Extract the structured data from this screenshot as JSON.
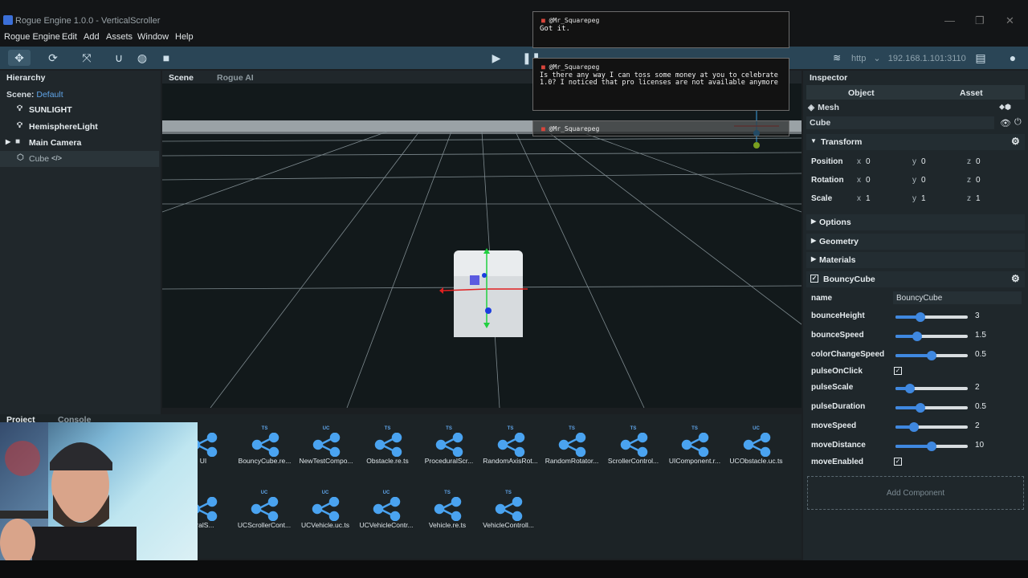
{
  "window": {
    "title": "Rogue Engine 1.0.0 - VerticalScroller"
  },
  "menu": [
    "Rogue Engine",
    "Edit",
    "Add",
    "Assets",
    "Window",
    "Help"
  ],
  "toolbar": {
    "protocol": "http",
    "address": "192.168.1.101:3110"
  },
  "hierarchy": {
    "tab": "Hierarchy",
    "scene_label": "Scene:",
    "scene_name": "Default",
    "items": [
      {
        "label": "SUNLIGHT",
        "icon": "bulb-icon"
      },
      {
        "label": "HemisphereLight",
        "icon": "bulb-icon"
      },
      {
        "label": "Main Camera",
        "icon": "camera-icon"
      },
      {
        "label": "Cube",
        "icon": "cube-icon"
      }
    ]
  },
  "scene_tabs": [
    "Scene",
    "Rogue AI"
  ],
  "bottom_tabs": [
    "Project",
    "Console"
  ],
  "assets_row1": [
    {
      "name": "UI",
      "tag": ""
    },
    {
      "name": "BouncyCube.re...",
      "tag": "TS"
    },
    {
      "name": "NewTestCompo...",
      "tag": "UC"
    },
    {
      "name": "Obstacle.re.ts",
      "tag": "TS"
    },
    {
      "name": "ProceduralScr...",
      "tag": "TS"
    },
    {
      "name": "RandomAxisRot...",
      "tag": "TS"
    },
    {
      "name": "RandomRotator...",
      "tag": "TS"
    },
    {
      "name": "ScrollerControl...",
      "tag": "TS"
    },
    {
      "name": "UIComponent.r...",
      "tag": "TS"
    },
    {
      "name": "UCObstacle.uc.ts",
      "tag": "UC"
    }
  ],
  "assets_row2": [
    {
      "name": "uralS...",
      "tag": ""
    },
    {
      "name": "UCScrollerCont...",
      "tag": "UC"
    },
    {
      "name": "UCVehicle.uc.ts",
      "tag": "UC"
    },
    {
      "name": "UCVehicleContr...",
      "tag": "UC"
    },
    {
      "name": "Vehicle.re.ts",
      "tag": "TS"
    },
    {
      "name": "VehicleControll...",
      "tag": "TS"
    }
  ],
  "inspector": {
    "tab": "Inspector",
    "subtabs": [
      "Object",
      "Asset"
    ],
    "type": "Mesh",
    "object_name": "Cube",
    "transform": {
      "title": "Transform",
      "position_label": "Position",
      "position": {
        "x": "0",
        "y": "0",
        "z": "0"
      },
      "rotation_label": "Rotation",
      "rotation": {
        "x": "0",
        "y": "0",
        "z": "0"
      },
      "scale_label": "Scale",
      "scale": {
        "x": "1",
        "y": "1",
        "z": "1"
      }
    },
    "sections": [
      "Options",
      "Geometry",
      "Materials"
    ],
    "component": {
      "title": "BouncyCube",
      "name_label": "name",
      "name_value": "BouncyCube",
      "props": [
        {
          "label": "bounceHeight",
          "value": "3",
          "fraction": 0.35
        },
        {
          "label": "bounceSpeed",
          "value": "1.5",
          "fraction": 0.3
        },
        {
          "label": "colorChangeSpeed",
          "value": "0.5",
          "fraction": 0.5
        },
        {
          "label": "pulseScale",
          "value": "2",
          "fraction": 0.2
        },
        {
          "label": "pulseDuration",
          "value": "0.5",
          "fraction": 0.35
        },
        {
          "label": "moveSpeed",
          "value": "2",
          "fraction": 0.25
        },
        {
          "label": "moveDistance",
          "value": "10",
          "fraction": 0.5
        }
      ],
      "pulseOnClick_label": "pulseOnClick",
      "moveEnabled_label": "moveEnabled"
    },
    "add_component": "Add Component"
  },
  "chat": [
    {
      "user": "@Mr_Squarepeg",
      "message": "Got it."
    },
    {
      "user": "@Mr_Squarepeg",
      "message": "Is there any way I can toss some money at you to celebrate 1.0? I noticed that pro licenses are not available anymore"
    },
    {
      "user": "@Mr_Squarepeg",
      "message": ""
    }
  ],
  "colors": {
    "accent": "#3f88e0",
    "toolbar": "#2a4556",
    "panel": "#20272b",
    "chat_marker": "#d9453b"
  }
}
